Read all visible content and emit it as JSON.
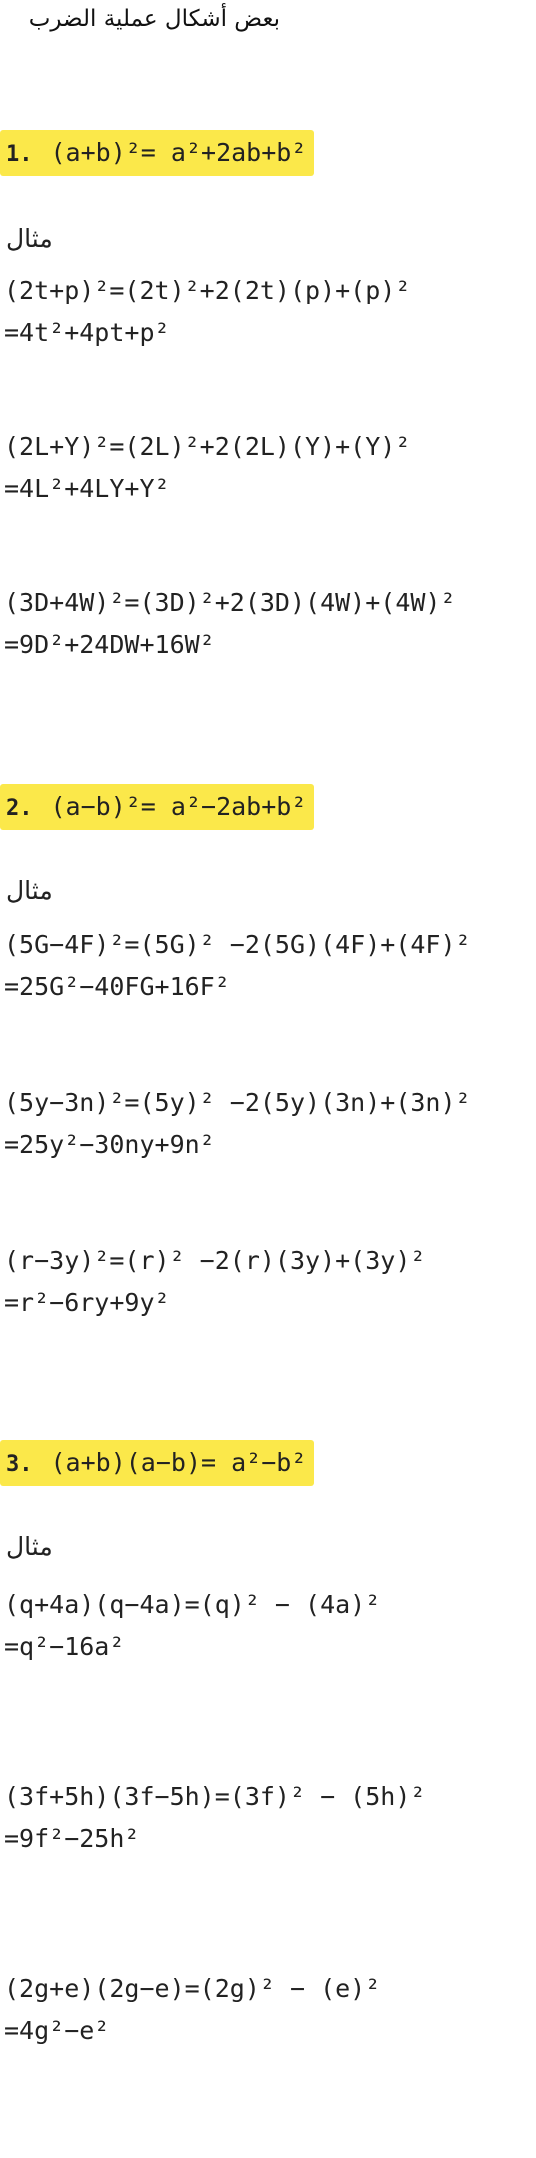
{
  "title": "بعض أشكال عملية الضرب",
  "example_label": "مثال",
  "sections": [
    {
      "number": "1.",
      "formula": "(a+b)²= a²+2ab+b²",
      "examples": [
        {
          "line1": "(2t+p)²=(2t)²+2(2t)(p)+(p)²",
          "line2": "=4t²+4pt+p²"
        },
        {
          "line1": "(2L+Y)²=(2L)²+2(2L)(Y)+(Y)²",
          "line2": "=4L²+4LY+Y²"
        },
        {
          "line1": "(3D+4W)²=(3D)²+2(3D)(4W)+(4W)²",
          "line2": "=9D²+24DW+16W²"
        }
      ]
    },
    {
      "number": "2.",
      "formula": "(a−b)²= a²−2ab+b²",
      "examples": [
        {
          "line1": "(5G−4F)²=(5G)² −2(5G)(4F)+(4F)²",
          "line2": "=25G²−40FG+16F²"
        },
        {
          "line1": "(5y−3n)²=(5y)² −2(5y)(3n)+(3n)²",
          "line2": "=25y²−30ny+9n²"
        },
        {
          "line1": "(r−3y)²=(r)² −2(r)(3y)+(3y)²",
          "line2": "=r²−6ry+9y²"
        }
      ]
    },
    {
      "number": "3.",
      "formula": "(a+b)(a−b)= a²−b²",
      "examples": [
        {
          "line1": "(q+4a)(q−4a)=(q)² − (4a)²",
          "line2": "=q²−16a²"
        },
        {
          "line1": "(3f+5h)(3f−5h)=(3f)² − (5h)²",
          "line2": "=9f²−25h²"
        },
        {
          "line1": "(2g+e)(2g−e)=(2g)² − (e)²",
          "line2": "=4g²−e²"
        }
      ]
    }
  ]
}
